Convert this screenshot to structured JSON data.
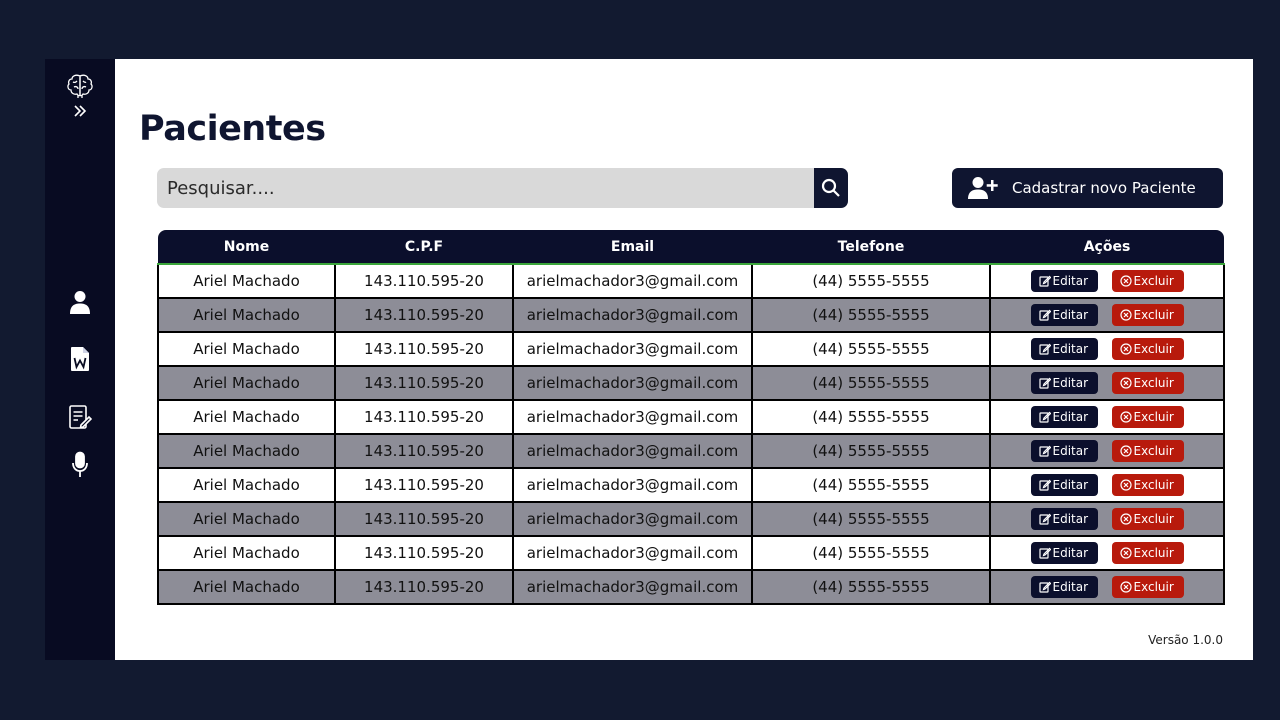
{
  "page": {
    "title": "Pacientes",
    "search_placeholder": "Pesquisar....",
    "add_button_label": "Cadastrar novo Paciente",
    "version": "Versão 1.0.0"
  },
  "sidebar": {
    "icons": [
      "brain-logo-icon",
      "expand-chevrons-icon",
      "user-icon",
      "word-document-icon",
      "notes-edit-icon",
      "microphone-icon"
    ]
  },
  "table": {
    "headers": [
      "Nome",
      "C.P.F",
      "Email",
      "Telefone",
      "Ações"
    ],
    "edit_label": "Editar",
    "delete_label": "Excluir",
    "rows": [
      [
        "Ariel Machado",
        "143.110.595-20",
        "arielmachador3@gmail.com",
        "(44) 5555-5555"
      ],
      [
        "Ariel Machado",
        "143.110.595-20",
        "arielmachador3@gmail.com",
        "(44) 5555-5555"
      ],
      [
        "Ariel Machado",
        "143.110.595-20",
        "arielmachador3@gmail.com",
        "(44) 5555-5555"
      ],
      [
        "Ariel Machado",
        "143.110.595-20",
        "arielmachador3@gmail.com",
        "(44) 5555-5555"
      ],
      [
        "Ariel Machado",
        "143.110.595-20",
        "arielmachador3@gmail.com",
        "(44) 5555-5555"
      ],
      [
        "Ariel Machado",
        "143.110.595-20",
        "arielmachador3@gmail.com",
        "(44) 5555-5555"
      ],
      [
        "Ariel Machado",
        "143.110.595-20",
        "arielmachador3@gmail.com",
        "(44) 5555-5555"
      ],
      [
        "Ariel Machado",
        "143.110.595-20",
        "arielmachador3@gmail.com",
        "(44) 5555-5555"
      ],
      [
        "Ariel Machado",
        "143.110.595-20",
        "arielmachador3@gmail.com",
        "(44) 5555-5555"
      ],
      [
        "Ariel Machado",
        "143.110.595-20",
        "arielmachador3@gmail.com",
        "(44) 5555-5555"
      ]
    ]
  },
  "colors": {
    "background": "#121a30",
    "sidebar": "#080b22",
    "primary": "#0f1530",
    "danger": "#b81a0c",
    "row_alt": "#8d8d97",
    "header_underline": "#3aa53a"
  }
}
